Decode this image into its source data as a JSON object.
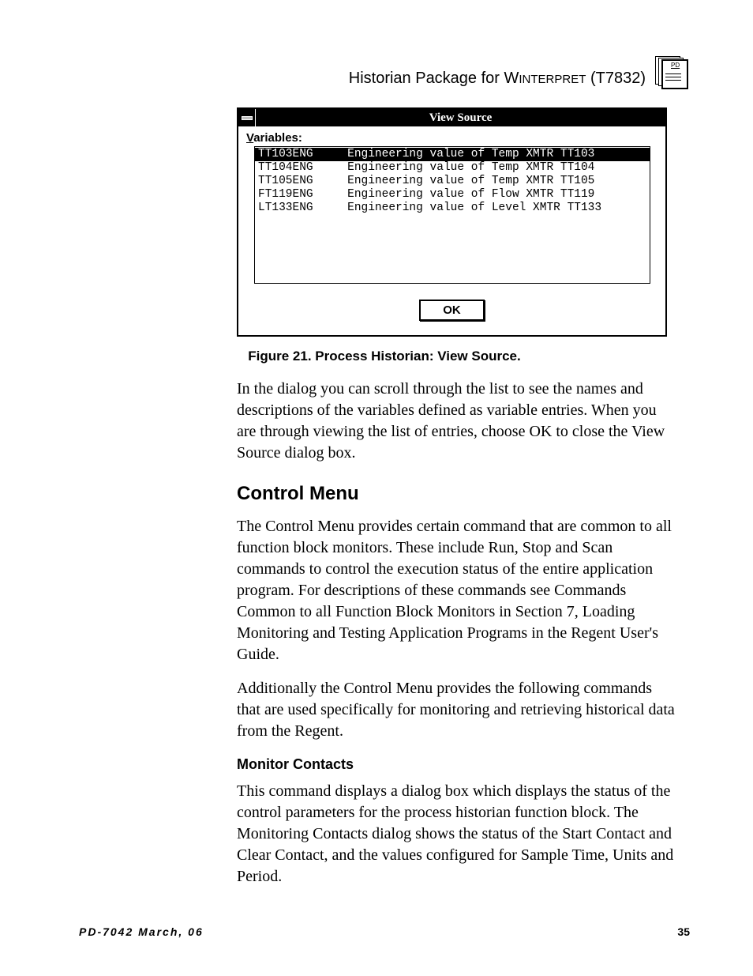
{
  "header": {
    "title_prefix": "Historian  Package  for W",
    "title_small": "INTERPRET",
    "title_suffix": " (T7832)",
    "icon_label": "PD"
  },
  "dialog": {
    "title": "View Source",
    "variables_label": "Variables:",
    "rows": [
      {
        "name": "TT103ENG",
        "desc": "Engineering value of Temp XMTR TT103",
        "selected": true
      },
      {
        "name": "TT104ENG",
        "desc": "Engineering value of Temp XMTR TT104",
        "selected": false
      },
      {
        "name": "TT105ENG",
        "desc": "Engineering value of Temp XMTR TT105",
        "selected": false
      },
      {
        "name": "FT119ENG",
        "desc": "Engineering value of Flow XMTR TT119",
        "selected": false
      },
      {
        "name": "LT133ENG",
        "desc": "Engineering value of Level XMTR TT133",
        "selected": false
      }
    ],
    "ok_label": "OK"
  },
  "figure_caption": "Figure 21.  Process Historian: View Source.",
  "body": {
    "p1": "In the dialog you can scroll through the list to see the names and descriptions of the variables defined as variable entries. When you are through viewing the list of entries, choose OK to close the View Source dialog box.",
    "h2": "Control Menu",
    "p2": "The Control Menu provides certain command that are common to all function block monitors.  These include Run, Stop and Scan commands to control the execution status of the entire application program.  For descriptions of these commands see Commands Common to all Function Block Monitors in Section 7, Loading Monitoring and Testing Application Programs in the Regent User's Guide.",
    "p3": "Additionally the Control Menu provides the following commands that are used specifically for monitoring and retrieving historical data from the Regent.",
    "h3": "Monitor Contacts",
    "p4": "This command displays a dialog box which displays the status of the control parameters for the process historian function block.  The Monitoring Contacts dialog shows the status of the Start Contact and Clear Contact, and the values configured for Sample Time, Units and Period."
  },
  "footer": {
    "left": "PD-7042 March, 06",
    "right": "35"
  }
}
